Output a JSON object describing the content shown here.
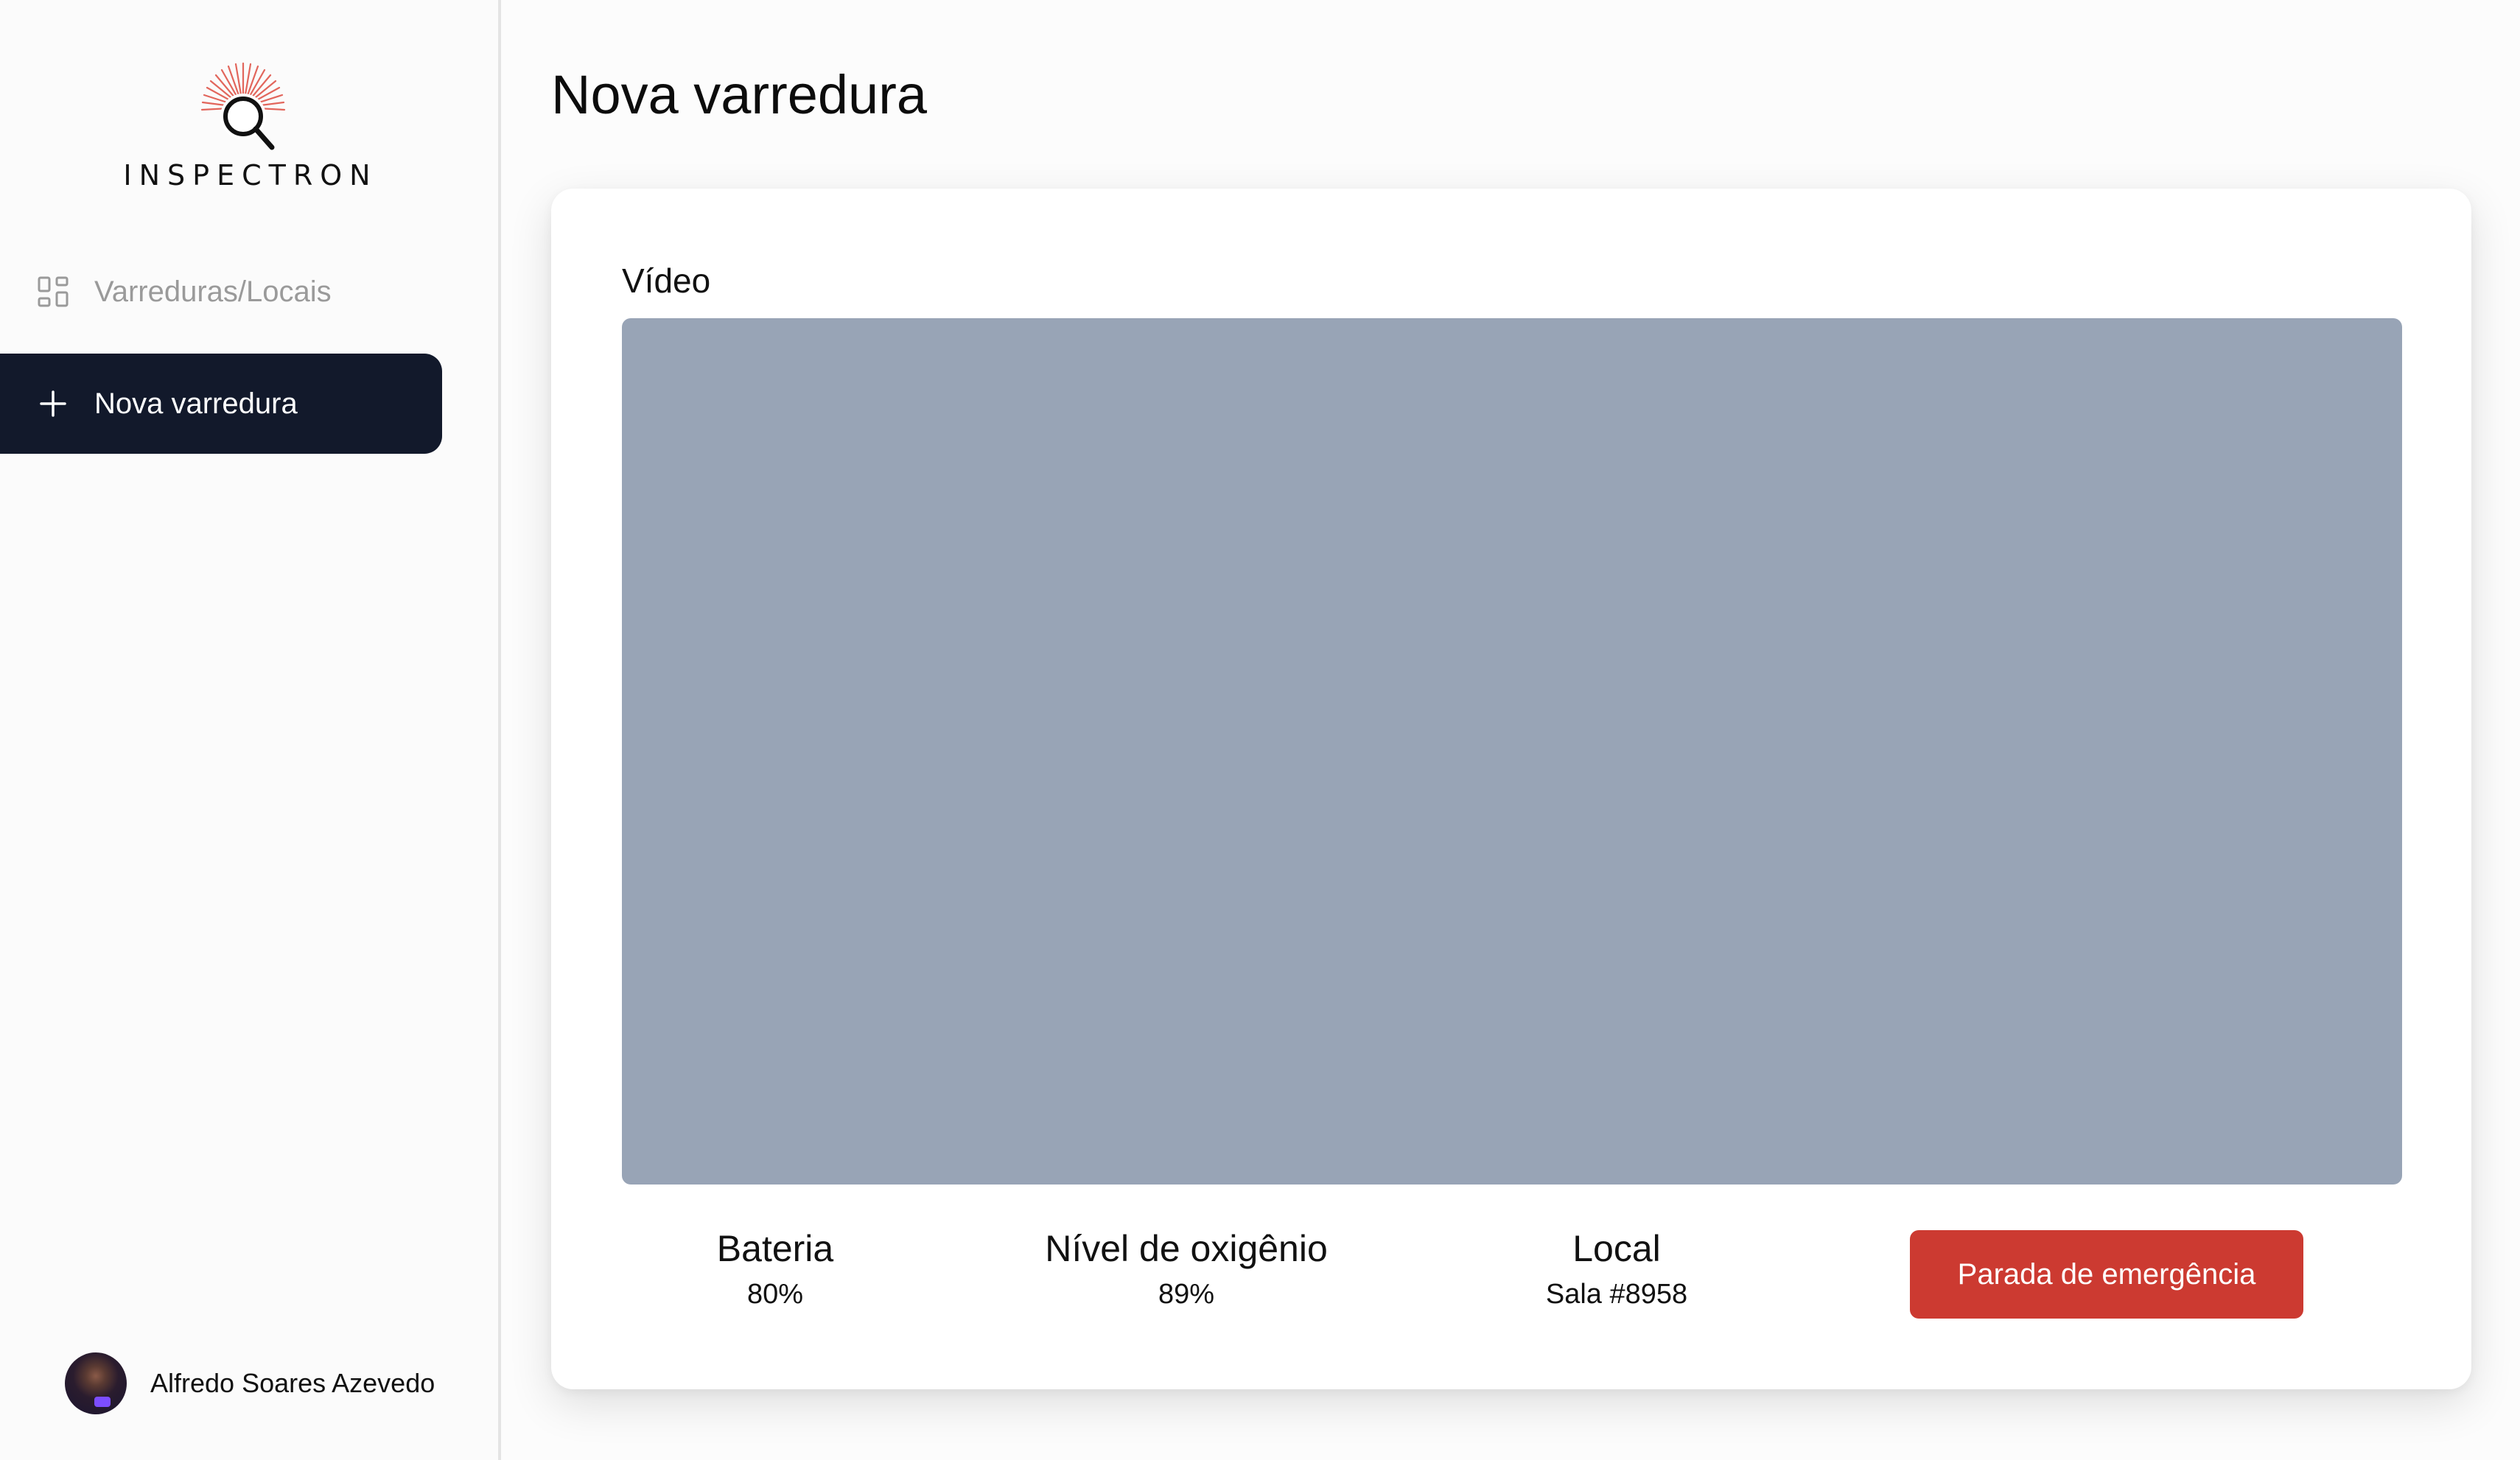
{
  "brand": {
    "name": "INSPECTRON",
    "accent_color": "#e2665c"
  },
  "sidebar": {
    "items": [
      {
        "label": "Varreduras/Locais",
        "icon": "grid-icon",
        "active": false
      },
      {
        "label": "Nova varredura",
        "icon": "plus-icon",
        "active": true
      }
    ],
    "active_bg": "#12192b"
  },
  "user": {
    "name": "Alfredo Soares Azevedo"
  },
  "page": {
    "title": "Nova varredura"
  },
  "card": {
    "video_label": "Vídeo",
    "video_placeholder_color": "#98a4b6",
    "stats": [
      {
        "label": "Bateria",
        "value": "80%"
      },
      {
        "label": "Nível de oxigênio",
        "value": "89%"
      },
      {
        "label": "Local",
        "value": "Sala #8958"
      }
    ],
    "emergency_label": "Parada de emergência",
    "emergency_color": "#cc3a31"
  }
}
